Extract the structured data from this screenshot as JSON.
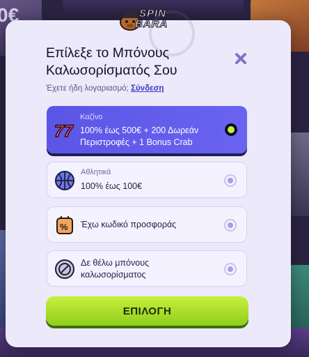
{
  "brand": {
    "logo_line1": "SPIN",
    "logo_line2": "BARA"
  },
  "modal": {
    "title": "Επίλεξε το Μπόνους Καλωσορίσματός Σου",
    "login_prompt": "Έχετε ήδη λογαριασμό;",
    "login_link": "Σύνδεση"
  },
  "options": [
    {
      "category": "Καζίνο",
      "text": "100% έως 500€ + 200 Δωρεάν Περιστροφές + 1 Bonus Crab",
      "icon": "slot-777-icon",
      "selected": true
    },
    {
      "category": "Αθλητικά",
      "text": "100% έως 100€",
      "icon": "basketball-icon",
      "selected": false
    },
    {
      "category": "",
      "text": "Έχω κωδικό προσφοράς",
      "icon": "promo-tag-icon",
      "selected": false
    },
    {
      "category": "",
      "text": "Δε θέλω μπόνους καλωσορίσματος",
      "icon": "no-bonus-icon",
      "selected": false
    }
  ],
  "cta": {
    "label": "ΕΠΙΛΟΓΗ"
  },
  "colors": {
    "accent": "#5b55e6",
    "cta": "#b4e32f",
    "modal_bg": "#ece9fb"
  },
  "background": {
    "currency_partial": "0€"
  }
}
